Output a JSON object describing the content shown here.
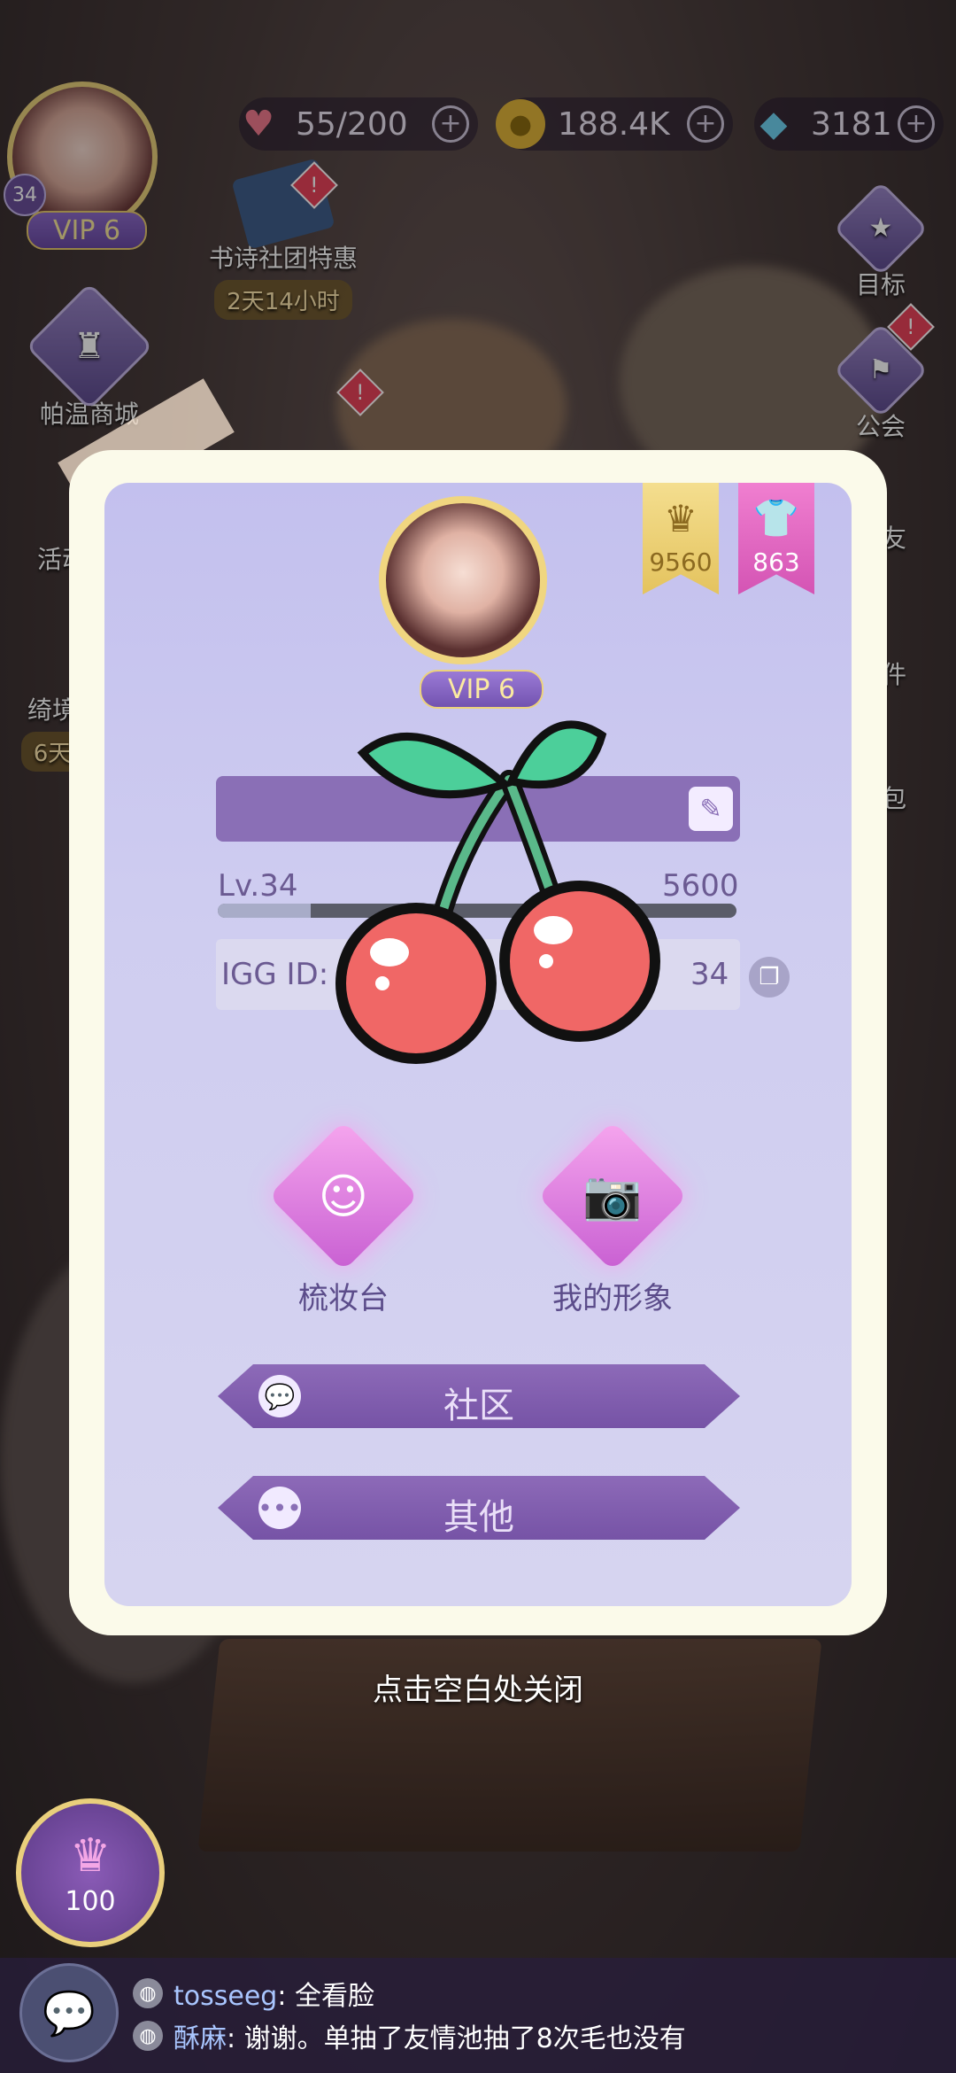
{
  "top": {
    "stamina": "55/200",
    "gold": "188.4K",
    "diamonds": "3181",
    "level": "34",
    "vip": "VIP 6"
  },
  "side_left": {
    "promo_title": "书诗社团特惠",
    "promo_timer": "2天14小时",
    "shop_label": "帕温商城",
    "event_label": "活动",
    "dream_label": "绮境",
    "dream_timer": "6天"
  },
  "side_right": {
    "goal_label": "目标",
    "guild_label": "公会",
    "friends_label": "友",
    "mail_label": "件",
    "bag_label": "包"
  },
  "card": {
    "crown_count": "9560",
    "clothes_count": "863",
    "vip": "VIP 6",
    "level_text": "Lv.34",
    "exp_text": "5600",
    "exp_fraction": 0.18,
    "igg_label": "IGG ID:",
    "igg_value": "34"
  },
  "features": [
    {
      "label": "梳妆台",
      "icon": "face-icon"
    },
    {
      "label": "我的形象",
      "icon": "camera-icon"
    }
  ],
  "buttons": {
    "community": "社区",
    "other": "其他"
  },
  "close_hint": "点击空白处关闭",
  "bottom": {
    "crown_value": "100"
  },
  "chat": [
    {
      "name": "tosseeg",
      "message": "全看脸"
    },
    {
      "name": "酥麻",
      "message": "谢谢。单抽了友情池抽了8次毛也没有"
    }
  ]
}
